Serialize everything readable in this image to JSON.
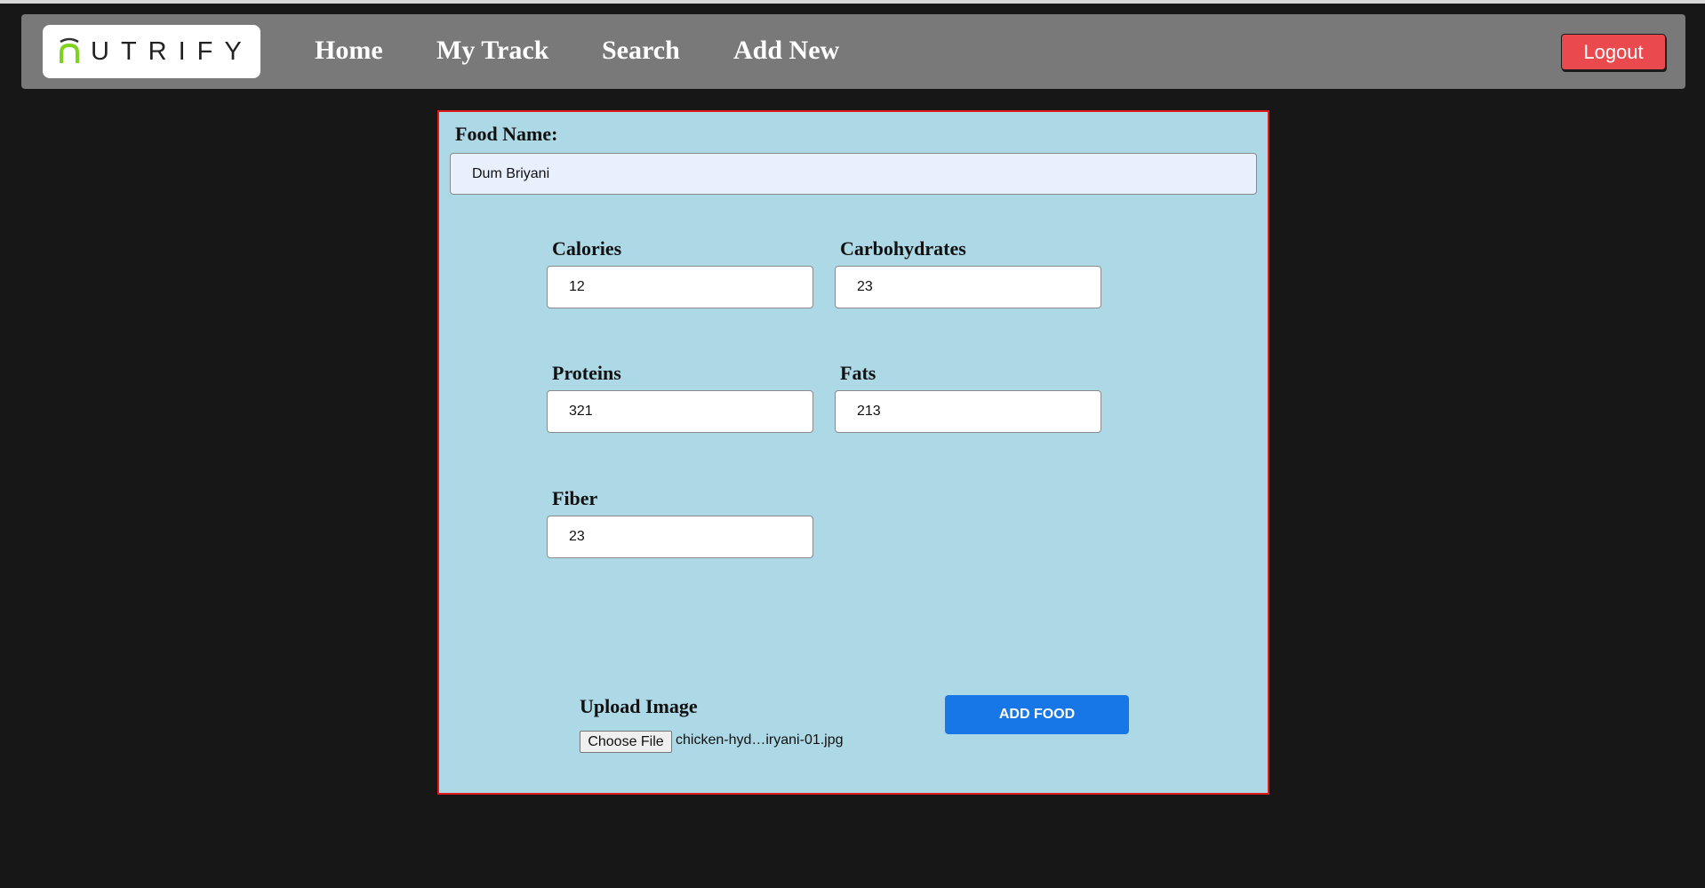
{
  "brand": {
    "logo_text": "UTRIFY",
    "logo_accent": "#7ed321"
  },
  "nav": {
    "home": "Home",
    "my_track": "My Track",
    "search": "Search",
    "add_new": "Add New",
    "logout": "Logout"
  },
  "form": {
    "food_name_label": "Food Name:",
    "food_name_value": "Dum Briyani",
    "calories_label": "Calories",
    "calories_value": "12",
    "carbohydrates_label": "Carbohydrates",
    "carbohydrates_value": "23",
    "proteins_label": "Proteins",
    "proteins_value": "321",
    "fats_label": "Fats",
    "fats_value": "213",
    "fiber_label": "Fiber",
    "fiber_value": "23",
    "upload_label": "Upload Image",
    "choose_file_label": "Choose File",
    "file_name": "chicken-hyd…iryani-01.jpg",
    "add_food_label": "ADD FOOD"
  },
  "colors": {
    "background": "#171717",
    "navbar": "#7a797a",
    "panel": "#add8e6",
    "panel_border": "#e01a1a",
    "logout": "#ea4a4e",
    "primary": "#1877e6"
  }
}
